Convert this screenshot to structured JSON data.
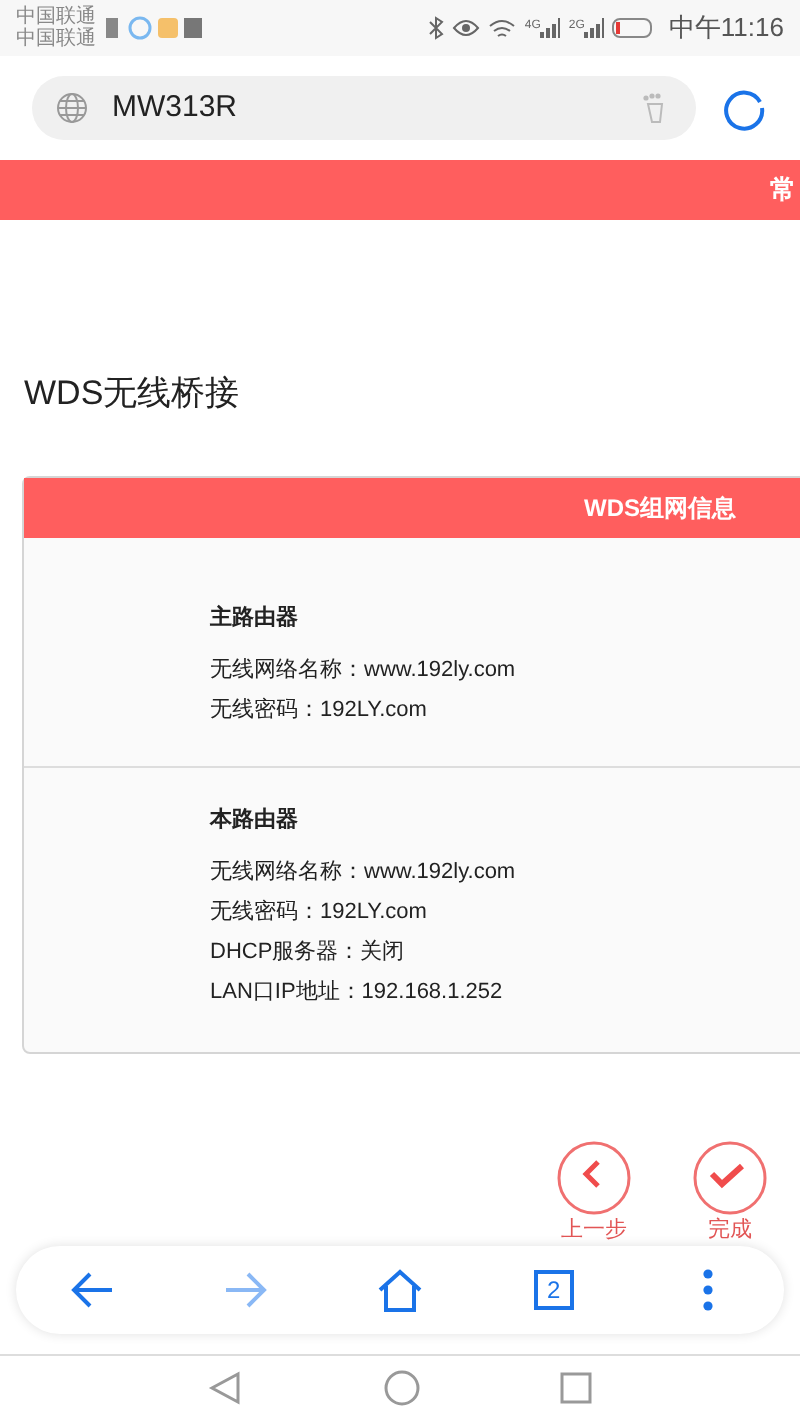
{
  "status_bar": {
    "carriers": [
      "中国联通",
      "中国联通"
    ],
    "network_labels": [
      "4G",
      "2G"
    ],
    "battery": {
      "level": 0.1
    },
    "time": "中午11:16"
  },
  "address_bar": {
    "url": "MW313R"
  },
  "banner": {
    "text": "常"
  },
  "page_title": "WDS无线桥接",
  "card": {
    "header": "WDS组网信息",
    "sections": [
      {
        "title": "主路由器",
        "lines": [
          "无线网络名称：www.192ly.com",
          "无线密码：192LY.com"
        ]
      },
      {
        "title": "本路由器",
        "lines": [
          "无线网络名称：www.192ly.com",
          "无线密码：192LY.com",
          "DHCP服务器：关闭",
          "LAN口IP地址：192.168.1.252"
        ]
      }
    ]
  },
  "actions": [
    {
      "kind": "back",
      "label": "上一步"
    },
    {
      "kind": "finish",
      "label": "完成"
    }
  ],
  "toolbar": [
    {
      "kind": "back",
      "disabled": false
    },
    {
      "kind": "forward",
      "disabled": true
    },
    {
      "kind": "home",
      "disabled": false
    },
    {
      "kind": "tabs",
      "count": "2",
      "disabled": false
    },
    {
      "kind": "menu",
      "disabled": false
    }
  ]
}
